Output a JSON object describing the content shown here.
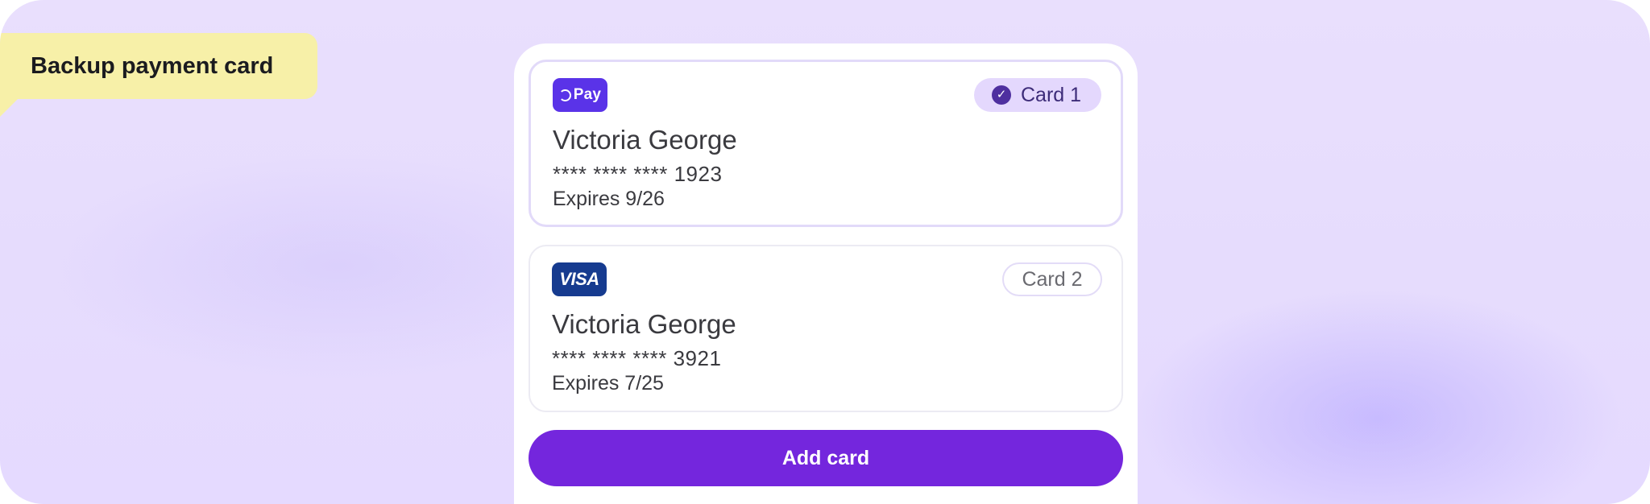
{
  "label": {
    "text": "Backup payment card"
  },
  "cards": [
    {
      "brand": "OPay",
      "brand_prefix": "Ɔ",
      "brand_word": "Pay",
      "chip": "Card 1",
      "selected": true,
      "holder": "Victoria George",
      "number": "**** **** **** 1923",
      "expiry": "Expires 9/26"
    },
    {
      "brand": "VISA",
      "chip": "Card 2",
      "selected": false,
      "holder": "Victoria George",
      "number": "**** **** **** 3921",
      "expiry": "Expires 7/25"
    }
  ],
  "actions": {
    "add_card": "Add card"
  },
  "icons": {
    "check": "✓"
  },
  "colors": {
    "accent": "#7426dd",
    "opay": "#5a33e8",
    "visa": "#163b8f",
    "selected_chip": "#e4d8fd",
    "label_bg": "#f7f0a8"
  }
}
